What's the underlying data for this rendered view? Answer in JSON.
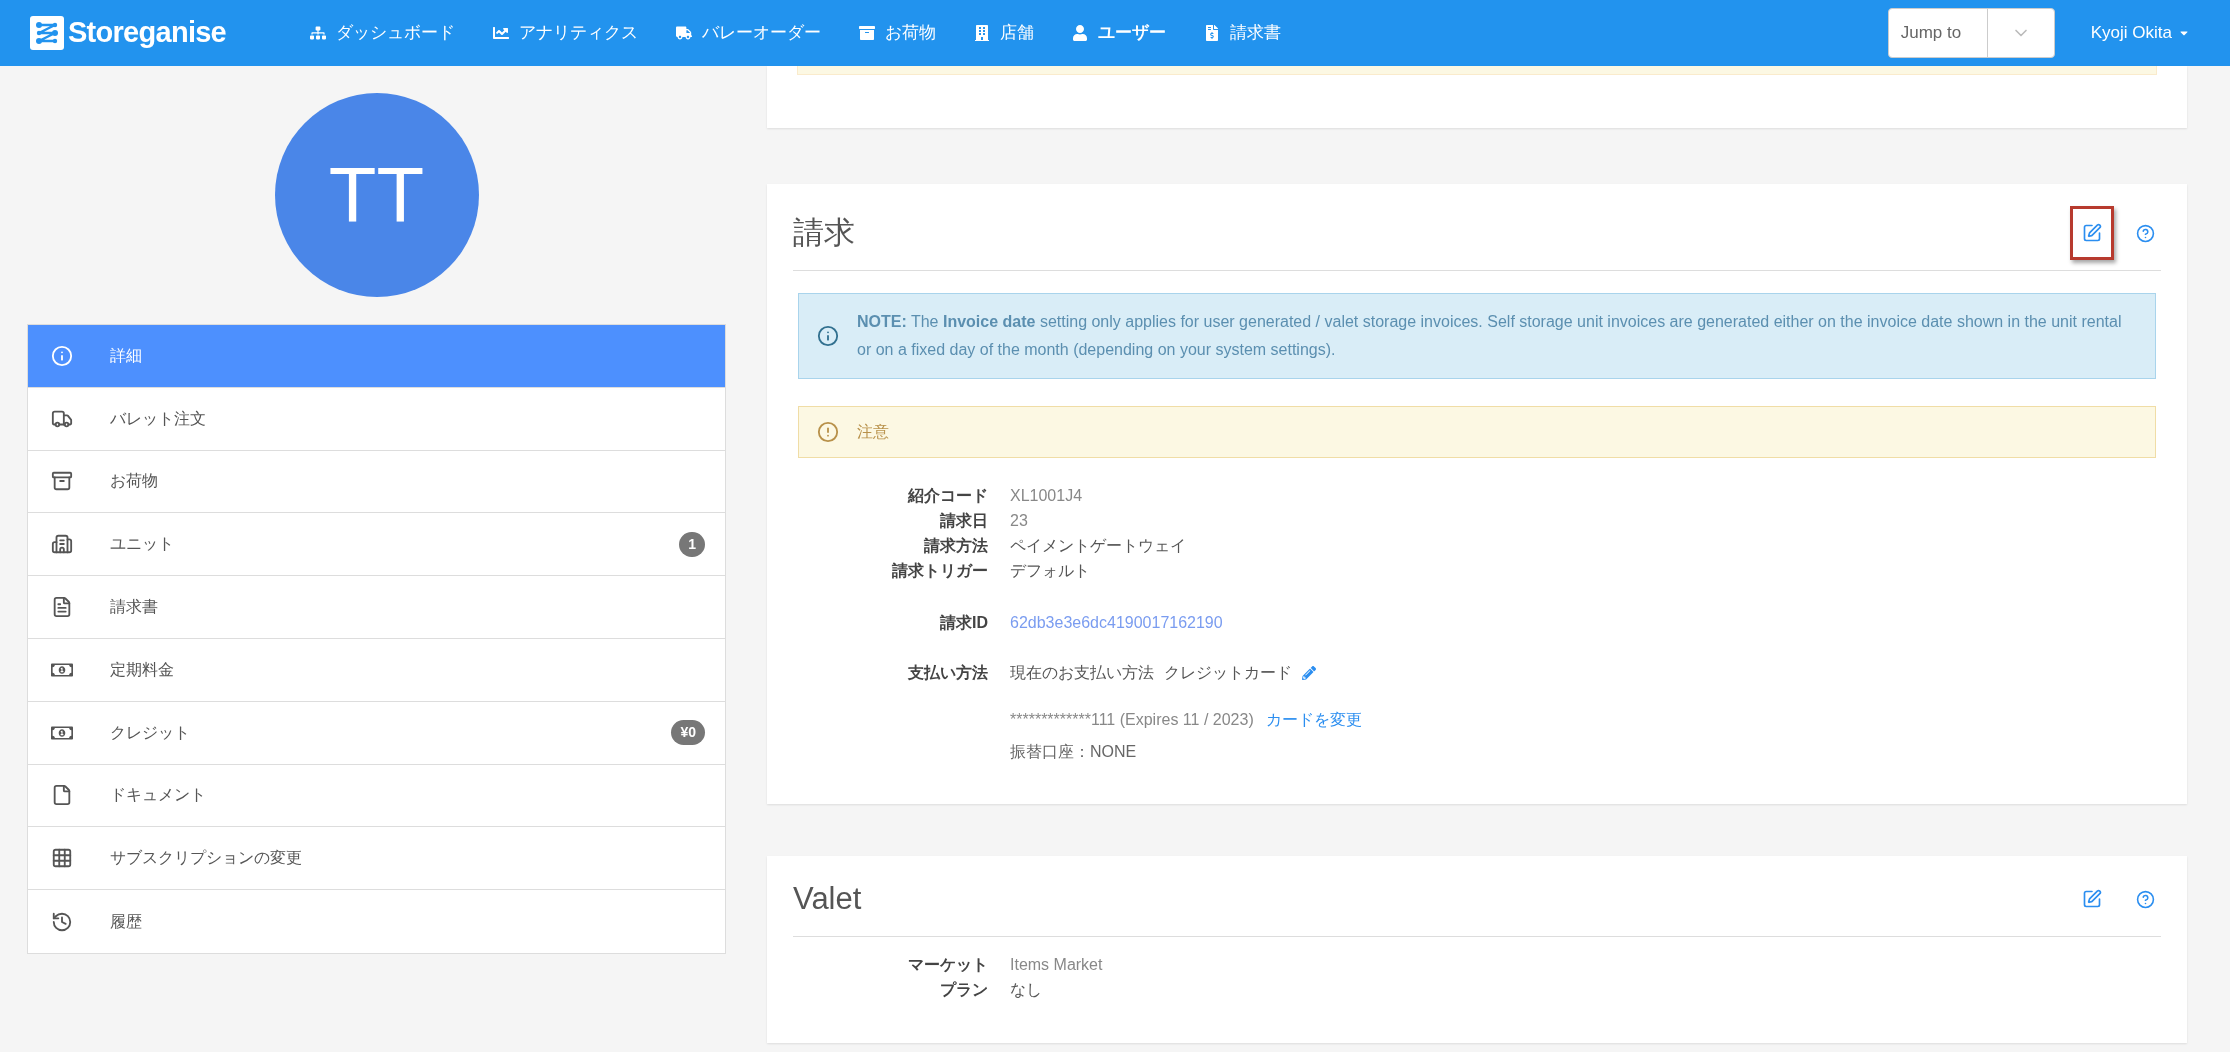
{
  "navbar": {
    "brand": "Storeganise",
    "items": [
      {
        "label": "ダッシュボード",
        "selected": false
      },
      {
        "label": "アナリティクス",
        "selected": false
      },
      {
        "label": "バレーオーダー",
        "selected": false
      },
      {
        "label": "お荷物",
        "selected": false
      },
      {
        "label": "店舗",
        "selected": false
      },
      {
        "label": "ユーザー",
        "selected": true
      },
      {
        "label": "請求書",
        "selected": false
      }
    ],
    "jump_to": {
      "placeholder": "Jump to"
    },
    "user": "Kyoji Okita"
  },
  "profile": {
    "initials": "TT"
  },
  "sidebar": {
    "items": [
      {
        "label": "詳細",
        "selected": true
      },
      {
        "label": "バレット注文",
        "selected": false
      },
      {
        "label": "お荷物",
        "selected": false
      },
      {
        "label": "ユニット",
        "selected": false,
        "badge": "1"
      },
      {
        "label": "請求書",
        "selected": false
      },
      {
        "label": "定期料金",
        "selected": false
      },
      {
        "label": "クレジット",
        "selected": false,
        "badge": "¥0"
      },
      {
        "label": "ドキュメント",
        "selected": false
      },
      {
        "label": "サブスクリプションの変更",
        "selected": false
      },
      {
        "label": "履歴",
        "selected": false
      }
    ]
  },
  "billing": {
    "title": "請求",
    "edit_highlighted": true,
    "note": "**NOTE:** The **Invoice date** setting only applies for user generated / valet storage invoices. Self storage unit invoices are generated either on the invoice date shown in the unit rental or on a fixed day of the month (depending on your system settings).",
    "warning": "注意",
    "fields": [
      {
        "label": "紹介コード",
        "value": "XL1001J4",
        "kind": "code"
      },
      {
        "label": "請求日",
        "value": "23",
        "kind": "code"
      },
      {
        "label": "請求方法",
        "value": "ペイメントゲートウェイ",
        "kind": "text"
      },
      {
        "label": "請求トリガー",
        "value": "デフォルト",
        "kind": "text"
      }
    ],
    "billing_id": {
      "label": "請求ID",
      "value": "62db3e3e6dc4190017162190"
    },
    "payment": {
      "label": "支払い方法",
      "current": "現在のお支払い方法",
      "method": "クレジットカード",
      "card": "*************111 (Expires 11 / 2023)",
      "change_link": "カードを変更",
      "bank_account": "振替口座：NONE"
    }
  },
  "valet": {
    "title": "Valet",
    "edit_highlighted": false,
    "fields": [
      {
        "label": "マーケット",
        "value": "Items Market",
        "kind": "code"
      },
      {
        "label": "プラン",
        "value": "なし",
        "kind": "text"
      }
    ]
  }
}
